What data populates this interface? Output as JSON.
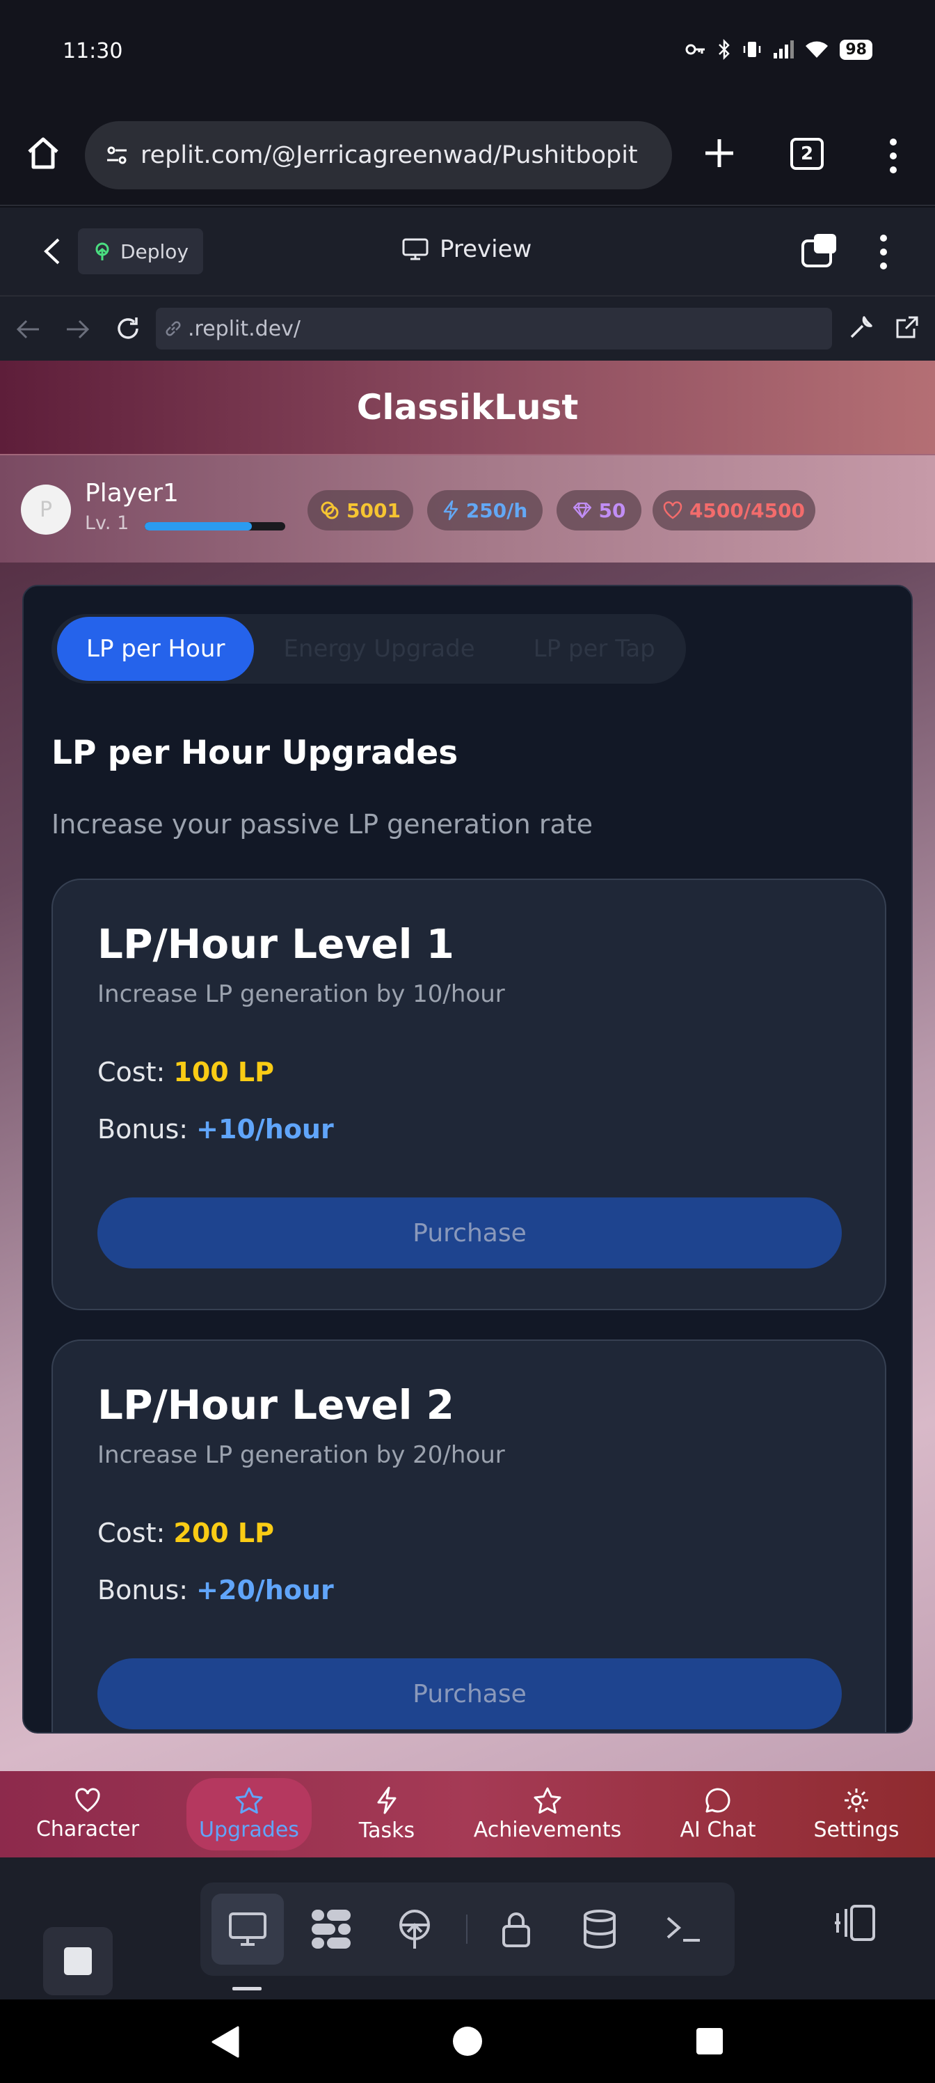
{
  "status": {
    "time": "11:30",
    "battery": "98"
  },
  "browser": {
    "url": "replit.com/@Jerricagreenwad/Pushitbopit",
    "tab_count": "2"
  },
  "replit": {
    "deploy_label": "Deploy",
    "preview_label": "Preview",
    "address": ".replit.dev/"
  },
  "app": {
    "title": "ClassikLust",
    "player": {
      "avatar_letter": "P",
      "name": "Player1",
      "level": "Lv. 1",
      "xp_progress": 0.76
    },
    "stats": {
      "coins": "5001",
      "energy_rate": "250/h",
      "gems": "50",
      "hearts": "4500/4500"
    },
    "tabs": [
      "LP per Hour",
      "Energy Upgrade",
      "LP per Tap"
    ],
    "active_tab": 0,
    "section_title": "LP per Hour Upgrades",
    "section_subtitle": "Increase your passive LP generation rate",
    "upgrades": [
      {
        "title": "LP/Hour Level 1",
        "description": "Increase LP generation by 10/hour",
        "cost_label": "Cost: ",
        "cost": "100 LP",
        "bonus_label": "Bonus: ",
        "bonus": "+10/hour",
        "button": "Purchase"
      },
      {
        "title": "LP/Hour Level 2",
        "description": "Increase LP generation by 20/hour",
        "cost_label": "Cost: ",
        "cost": "200 LP",
        "bonus_label": "Bonus: ",
        "bonus": "+20/hour",
        "button": "Purchase"
      }
    ],
    "bottom_nav": [
      {
        "label": "Character",
        "icon": "heart-icon"
      },
      {
        "label": "Upgrades",
        "icon": "star-icon"
      },
      {
        "label": "Tasks",
        "icon": "lightning-icon"
      },
      {
        "label": "Achievements",
        "icon": "star-icon"
      },
      {
        "label": "AI Chat",
        "icon": "chat-bubble-icon"
      },
      {
        "label": "Settings",
        "icon": "gear-icon"
      }
    ],
    "active_nav": "Upgrades"
  },
  "colors": {
    "accent": "#2563eb",
    "coins": "#facc15",
    "energy": "#60a5fa",
    "gems": "#c18ef5",
    "hearts": "#f36c6c"
  }
}
